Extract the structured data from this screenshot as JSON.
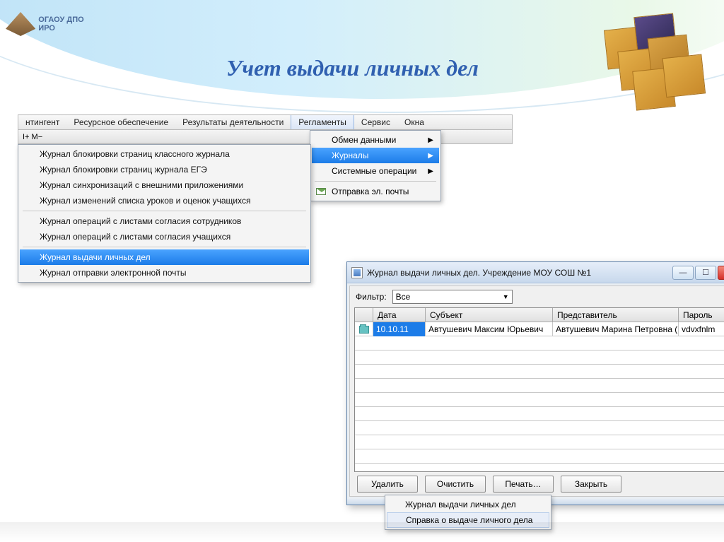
{
  "slide": {
    "title": "Учет выдачи личных дел"
  },
  "logo": {
    "text": "ОГАОУ ДПО ИРО"
  },
  "menubar": {
    "items": [
      "нтингент",
      "Ресурсное обеспечение",
      "Результаты деятельности",
      "Регламенты",
      "Сервис",
      "Окна"
    ],
    "toolbar": "I+  M−"
  },
  "dd_reglamenty": {
    "items": [
      {
        "label": "Обмен данными",
        "arrow": true
      },
      {
        "label": "Журналы",
        "arrow": true,
        "hover": true
      },
      {
        "label": "Системные операции",
        "arrow": true
      }
    ],
    "mail": "Отправка эл. почты"
  },
  "dd_journals": {
    "items": [
      "Журнал блокировки страниц классного журнала",
      "Журнал блокировки страниц журнала ЕГЭ",
      "Журнал синхронизаций с внешними приложениями",
      "Журнал изменений списка уроков и оценок учащихся"
    ],
    "group2": [
      "Журнал операций с листами согласия сотрудников",
      "Журнал операций с листами согласия учащихся"
    ],
    "group3": [
      "Журнал выдачи личных дел",
      "Журнал отправки электронной почты"
    ],
    "selected": "Журнал выдачи личных дел"
  },
  "window": {
    "title": "Журнал выдачи личных дел. Учреждение МОУ СОШ №1",
    "filter_label": "Фильтр:",
    "filter_value": "Все",
    "columns": {
      "date": "Дата",
      "subject": "Субъект",
      "rep": "Представитель",
      "pwd": "Пароль"
    },
    "row": {
      "date": "10.10.11",
      "subject": "Автушевич Максим Юрьевич",
      "rep": "Автушевич Марина Петровна (м",
      "pwd": "vdvxfnlm"
    },
    "buttons": {
      "delete": "Удалить",
      "clear": "Очистить",
      "print": "Печать…",
      "close": "Закрыть"
    }
  },
  "popup_print": {
    "items": [
      "Журнал выдачи личных дел",
      "Справка о выдаче личного дела"
    ]
  }
}
